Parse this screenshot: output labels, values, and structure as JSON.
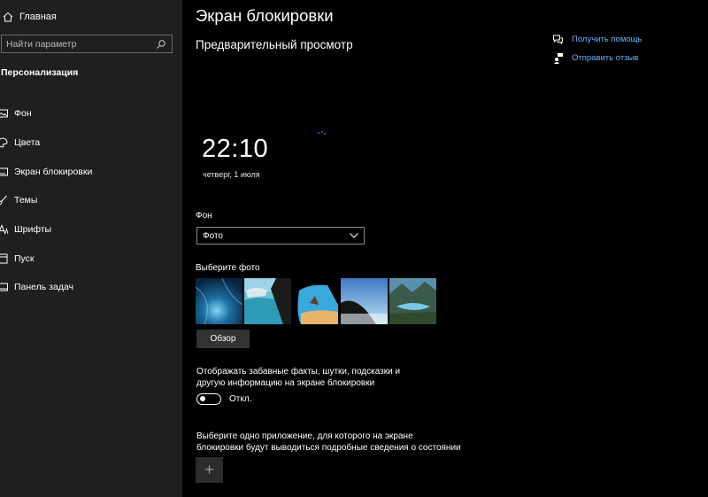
{
  "sidebar": {
    "home_label": "Главная",
    "search_placeholder": "Найти параметр",
    "section_title": "Персонализация",
    "items": [
      {
        "label": "Фон",
        "icon": "image-icon"
      },
      {
        "label": "Цвета",
        "icon": "palette-icon"
      },
      {
        "label": "Экран блокировки",
        "icon": "lock-screen-icon"
      },
      {
        "label": "Темы",
        "icon": "brush-icon"
      },
      {
        "label": "Шрифты",
        "icon": "font-icon"
      },
      {
        "label": "Пуск",
        "icon": "start-icon"
      },
      {
        "label": "Панель задач",
        "icon": "taskbar-icon"
      }
    ]
  },
  "main": {
    "page_title": "Экран блокировки",
    "preview_title": "Предварительный просмотр",
    "preview_time": "22:10",
    "preview_date": "четверг, 1 июля",
    "background_label": "Фон",
    "background_value": "Фото",
    "choose_photo_label": "Выберите фото",
    "browse_button": "Обзор",
    "facts_text": "Отображать забавные факты, шутки, подсказки и другую информацию на экране блокировки",
    "facts_toggle_state": "Откл.",
    "app_text": "Выберите одно приложение, для которого на экране блокировки будут выводиться подробные сведения о состоянии",
    "add_button": "+"
  },
  "links": {
    "help": "Получить помощь",
    "feedback": "Отправить отзыв"
  },
  "colors": {
    "sidebar_bg": "#1f1f1f",
    "main_bg": "#000000",
    "link": "#66b4ff",
    "button_bg": "#333333"
  }
}
